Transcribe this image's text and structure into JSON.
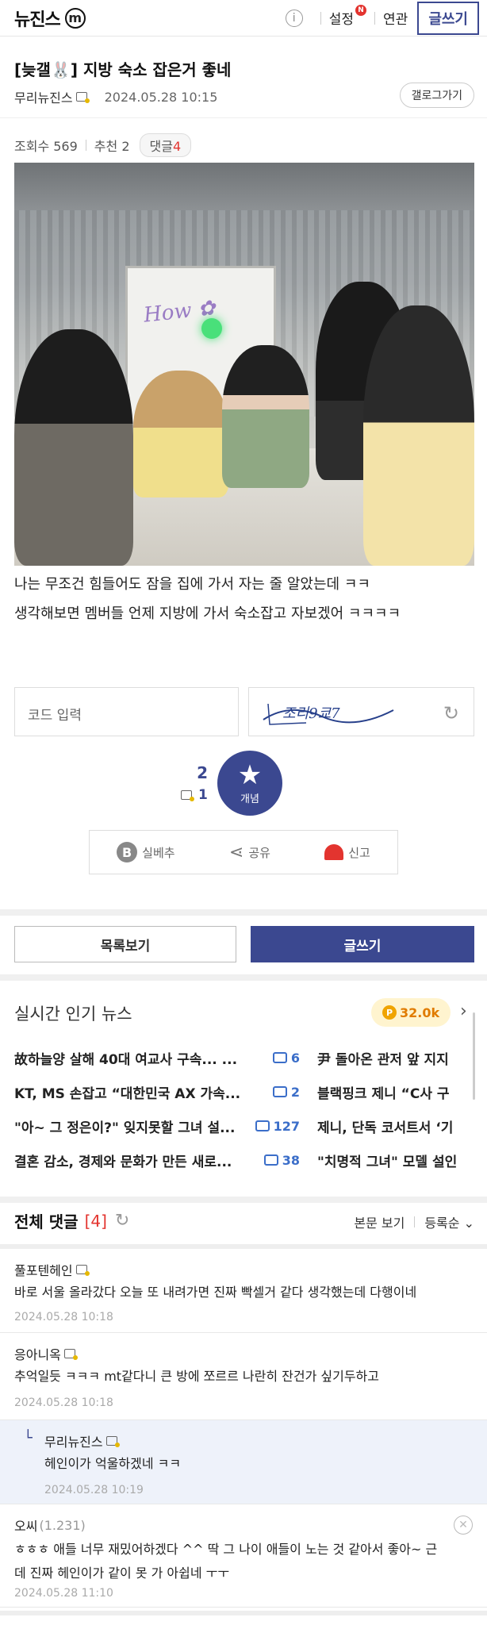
{
  "topbar": {
    "brand": "뉴진스",
    "brand_badge": "m",
    "info_icon": "i",
    "settings": "설정",
    "settings_badge": "N",
    "related": "연관",
    "write": "글쓰기"
  },
  "post": {
    "title": "[늦갤🐰] 지방 숙소 잡은거 좋네",
    "author": "무리뉴진스",
    "date": "2024.05.28 10:15",
    "gallery_button": "갤로그가기",
    "views": "조회수 569",
    "recommend": "추천 2",
    "comments_pill_label": "댓글",
    "comments_pill_count": "4",
    "body_line1": "나는 무조건 힘들어도 잠을 집에 가서 자는 줄 알았는데 ㅋㅋ",
    "body_line2": "생각해보면 멤버들 언제 지방에 가서 숙소잡고 자보겠어 ㅋㅋㅋㅋ"
  },
  "captcha": {
    "placeholder": "코드 입력",
    "image_text": "조리9쿄7"
  },
  "recommend_box": {
    "count": "2",
    "fixed_count": "1",
    "button_label": "개념"
  },
  "actions": {
    "downvote_icon": "B",
    "downvote": "실베추",
    "share": "공유",
    "report": "신고"
  },
  "buttons": {
    "list": "목록보기",
    "write": "글쓰기"
  },
  "news": {
    "title": "실시간 인기 뉴스",
    "points": "32.0k",
    "points_icon": "P",
    "rows": [
      {
        "title": "故하늘양 살해 40대 여교사 구속... ...",
        "count": "6",
        "right": "尹 돌아온 관저 앞 지지"
      },
      {
        "title": "KT, MS 손잡고 “대한민국 AX 가속...",
        "count": "2",
        "right": "블랙핑크 제니 “C사 구"
      },
      {
        "title": "\"아~ 그 정은이?\" 잊지못할 그녀 설...",
        "count": "127",
        "right": "제니, 단독 코서트서 ‘기"
      },
      {
        "title": "결혼 감소, 경제와 문화가 만든 새로...",
        "count": "38",
        "right": "\"치명적 그녀\" 모델 설인"
      }
    ]
  },
  "comments_section": {
    "title": "전체 댓글",
    "count": "[4]",
    "view_body": "본문 보기",
    "sort": "등록순",
    "items": [
      {
        "name": "풀포텐헤인",
        "text": "바로 서울 올라갔다 오늘 또 내려가면 진짜 빡셀거 같다 생각했는데 다행이네",
        "date": "2024.05.28 10:18"
      },
      {
        "name": "응아니옥",
        "text": "추억일듯 ㅋㅋㅋ mt같다니 큰 방에 쪼르르 나란히 잔건가 싶기두하고",
        "date": "2024.05.28 10:18"
      },
      {
        "name": "무리뉴진스",
        "text": "헤인이가 억울하겠네 ㅋㅋ",
        "date": "2024.05.28 10:19"
      },
      {
        "name": "오씨",
        "ip": "(1.231)",
        "text_line1": "ㅎㅎㅎ 애들 너무 재밌어하겠다 ^^ 딱 그 나이 애들이 노는 것 같아서 좋아~ 근",
        "text_line2": "데 진짜 헤인이가 같이 못 가 아쉽네 ㅜㅜ",
        "date": "2024.05.28 11:10"
      }
    ]
  },
  "colors": {
    "accent": "#3b4890",
    "red": "#e3342f",
    "link_blue": "#3b6ec9"
  }
}
